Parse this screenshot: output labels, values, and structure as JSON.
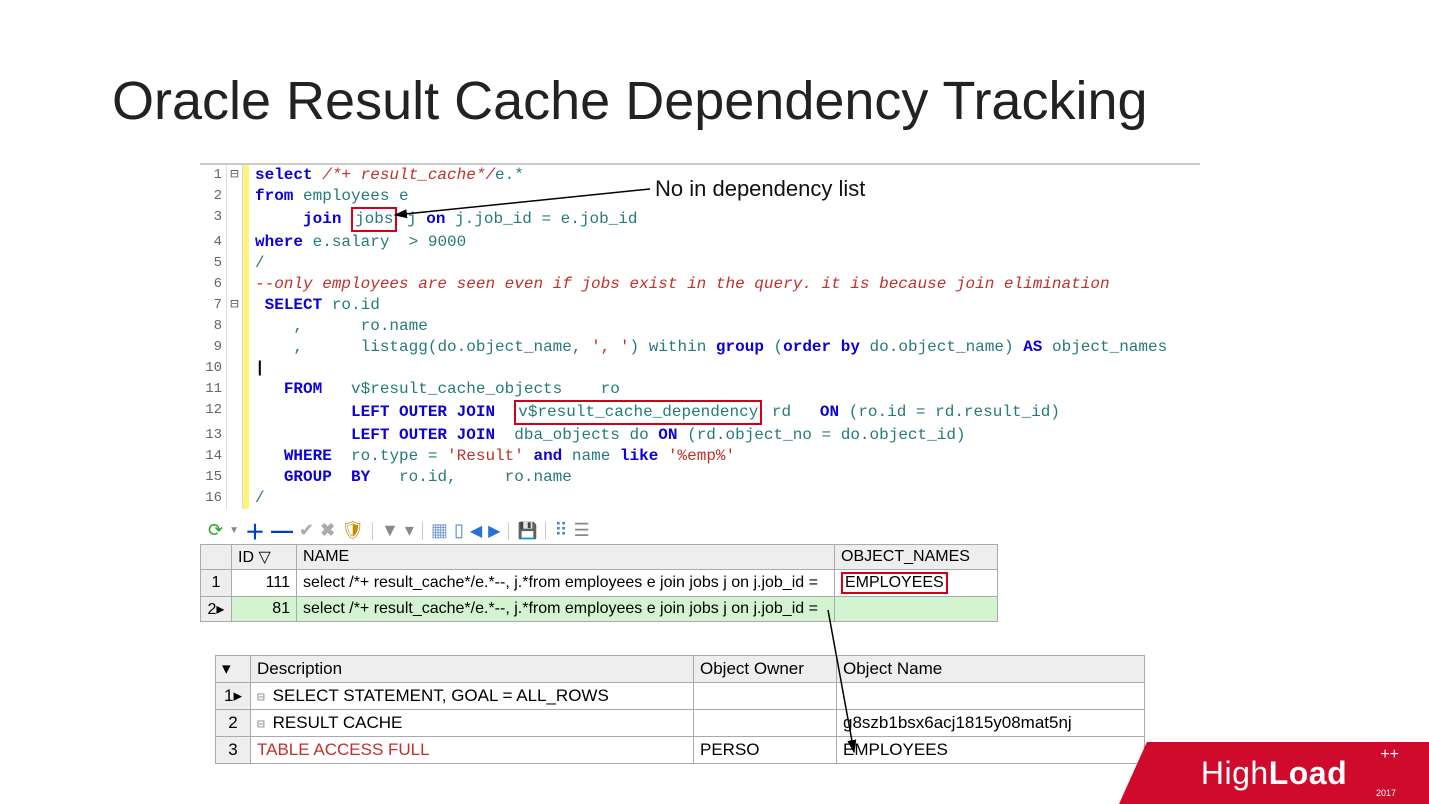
{
  "title": "Oracle Result Cache Dependency Tracking",
  "annotation1": "No in dependency list",
  "code": {
    "lines": [
      {
        "n": "1",
        "fold": "⊟"
      },
      {
        "n": "2",
        "fold": ""
      },
      {
        "n": "3",
        "fold": ""
      },
      {
        "n": "4",
        "fold": ""
      },
      {
        "n": "5",
        "fold": ""
      },
      {
        "n": "6",
        "fold": ""
      },
      {
        "n": "7",
        "fold": "⊟"
      },
      {
        "n": "8",
        "fold": ""
      },
      {
        "n": "9",
        "fold": ""
      },
      {
        "n": "10",
        "fold": ""
      },
      {
        "n": "11",
        "fold": ""
      },
      {
        "n": "12",
        "fold": ""
      },
      {
        "n": "13",
        "fold": ""
      },
      {
        "n": "14",
        "fold": ""
      },
      {
        "n": "15",
        "fold": ""
      },
      {
        "n": "16",
        "fold": ""
      }
    ],
    "l1_kw1": "select",
    "l1_cmt": " /*+ result_cache*/",
    "l1_id": "e.*",
    "l2_kw": "from",
    "l2_id": " employees e",
    "l3_pre": "     ",
    "l3_kw": "join",
    "l3_box": "jobs",
    "l3_rest": " j ",
    "l3_kw2": "on",
    "l3_rest2": " j.job_id = e.job_id",
    "l4_kw": "where",
    "l4_rest": " e.salary  > 9000",
    "l5": "/",
    "l6": "--only employees are seen even if jobs exist in the query. it is because join elimination",
    "l7_pre": " ",
    "l7_kw": "SELECT",
    "l7_rest": " ro.id",
    "l8": "    ,      ro.name",
    "l9_pre": "    ,      ",
    "l9_fn": "listagg",
    "l9_rest1": "(do.object_name, ",
    "l9_str": "', '",
    "l9_rest2": ") within ",
    "l9_kw": "group",
    "l9_rest3": " (",
    "l9_kw2": "order",
    "l9_rest4": " ",
    "l9_kw3": "by",
    "l9_rest5": " do.object_name) ",
    "l9_kw4": "AS",
    "l9_rest6": " object_names",
    "l10": "|",
    "l11_pre": "   ",
    "l11_kw": "FROM",
    "l11_rest": "   v$result_cache_objects    ro",
    "l12_pre": "          ",
    "l12_kw": "LEFT OUTER JOIN",
    "l12_sp": "  ",
    "l12_box": "v$result_cache_dependency",
    "l12_rest": " rd   ",
    "l12_kw2": "ON",
    "l12_rest2": " (ro.id = rd.result_id)",
    "l13_pre": "          ",
    "l13_kw": "LEFT OUTER JOIN",
    "l13_rest": "  dba_objects do ",
    "l13_kw2": "ON",
    "l13_rest2": " (rd.object_no = do.object_id)",
    "l14_pre": "   ",
    "l14_kw": "WHERE",
    "l14_rest": "  ro.type = ",
    "l14_str1": "'Result'",
    "l14_rest2": " ",
    "l14_kw2": "and",
    "l14_rest3": " name ",
    "l14_kw3": "like",
    "l14_rest4": " ",
    "l14_str2": "'%emp%'",
    "l15_pre": "   ",
    "l15_kw": "GROUP",
    "l15_sp": "  ",
    "l15_kw2": "BY",
    "l15_rest": "   ro.id,     ro.name",
    "l16": "/"
  },
  "grid1": {
    "headers": {
      "rownum": "",
      "id": "ID  ▽",
      "name": "NAME",
      "obj": "OBJECT_NAMES"
    },
    "rows": [
      {
        "rownum": "1",
        "id": "111",
        "name": "select /*+ result_cache*/e.*--, j.*from employees e    join jobs j on j.job_id =",
        "obj": "EMPLOYEES"
      },
      {
        "rownum": "2▸",
        "id": "81",
        "name": "select /*+ result_cache*/e.*--, j.*from employees e    join jobs j on j.job_id =",
        "obj": ""
      }
    ]
  },
  "grid2": {
    "headers": {
      "rownum": "",
      "desc": "Description",
      "owner": "Object Owner",
      "objname": "Object Name"
    },
    "rows": [
      {
        "rownum": "1▸",
        "tree": "⊟ ",
        "desc": "SELECT STATEMENT, GOAL = ALL_ROWS",
        "owner": "",
        "objname": ""
      },
      {
        "rownum": "2",
        "tree": "  ⊟ ",
        "desc": "RESULT CACHE",
        "owner": "",
        "objname": "g8szb1bsx6acj1815y08mat5nj"
      },
      {
        "rownum": "3",
        "tree": "    ",
        "desc_red": "TABLE ACCESS FULL",
        "owner": "PERSO",
        "objname": "EMPLOYEES"
      }
    ]
  },
  "logo": {
    "brand_pre": "High",
    "brand_bold": "Load",
    "plusplus": "++",
    "year": "2017"
  }
}
